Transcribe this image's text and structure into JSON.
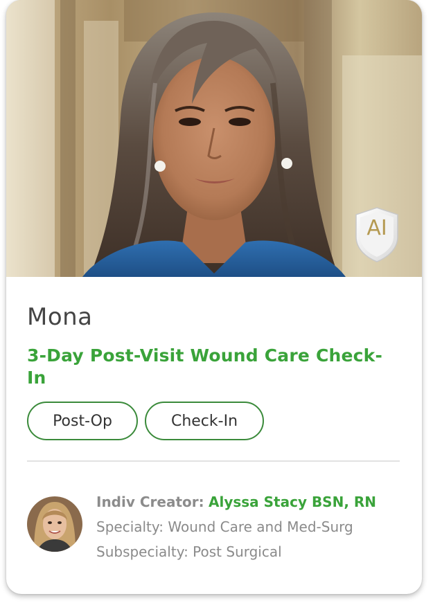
{
  "card": {
    "badge_label": "AI",
    "name": "Mona",
    "title": "3-Day Post-Visit Wound Care Check-In",
    "tags": [
      "Post-Op",
      "Check-In"
    ],
    "creator": {
      "label": "Indiv Creator:",
      "name": "Alyssa Stacy BSN, RN",
      "specialty": "Specialty: Wound Care and Med-Surg",
      "subspecialty": "Subspecialty: Post Surgical"
    }
  },
  "colors": {
    "accent_green": "#3aa33a",
    "tag_border": "#3a8a3a",
    "name_text": "#444444",
    "muted_text": "#8a8a8a"
  }
}
